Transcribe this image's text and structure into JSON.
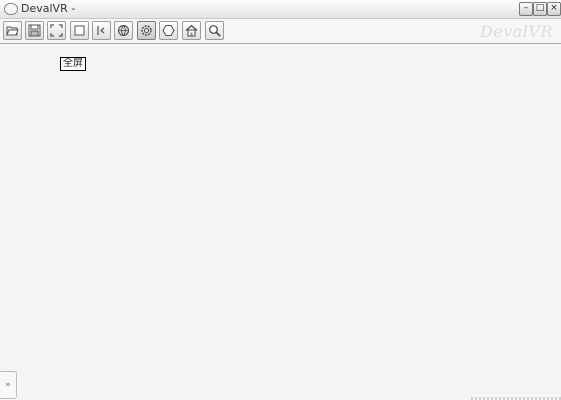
{
  "window": {
    "title": "DevalVR -",
    "minimize_label": "–",
    "maximize_label": "□",
    "close_label": "×"
  },
  "toolbar": {
    "logo_text": "DevalVR",
    "buttons": [
      {
        "name": "open-icon"
      },
      {
        "name": "save-icon"
      },
      {
        "name": "fullscreen-icon"
      },
      {
        "name": "single-view-icon"
      },
      {
        "name": "split-view-icon"
      },
      {
        "name": "sphere-icon"
      },
      {
        "name": "settings-icon",
        "active": true
      },
      {
        "name": "hexagon-icon"
      },
      {
        "name": "home-icon"
      },
      {
        "name": "zoom-icon"
      }
    ]
  },
  "canvas": {
    "tooltip_text": "全屏",
    "corner_button_glyph": "»"
  }
}
